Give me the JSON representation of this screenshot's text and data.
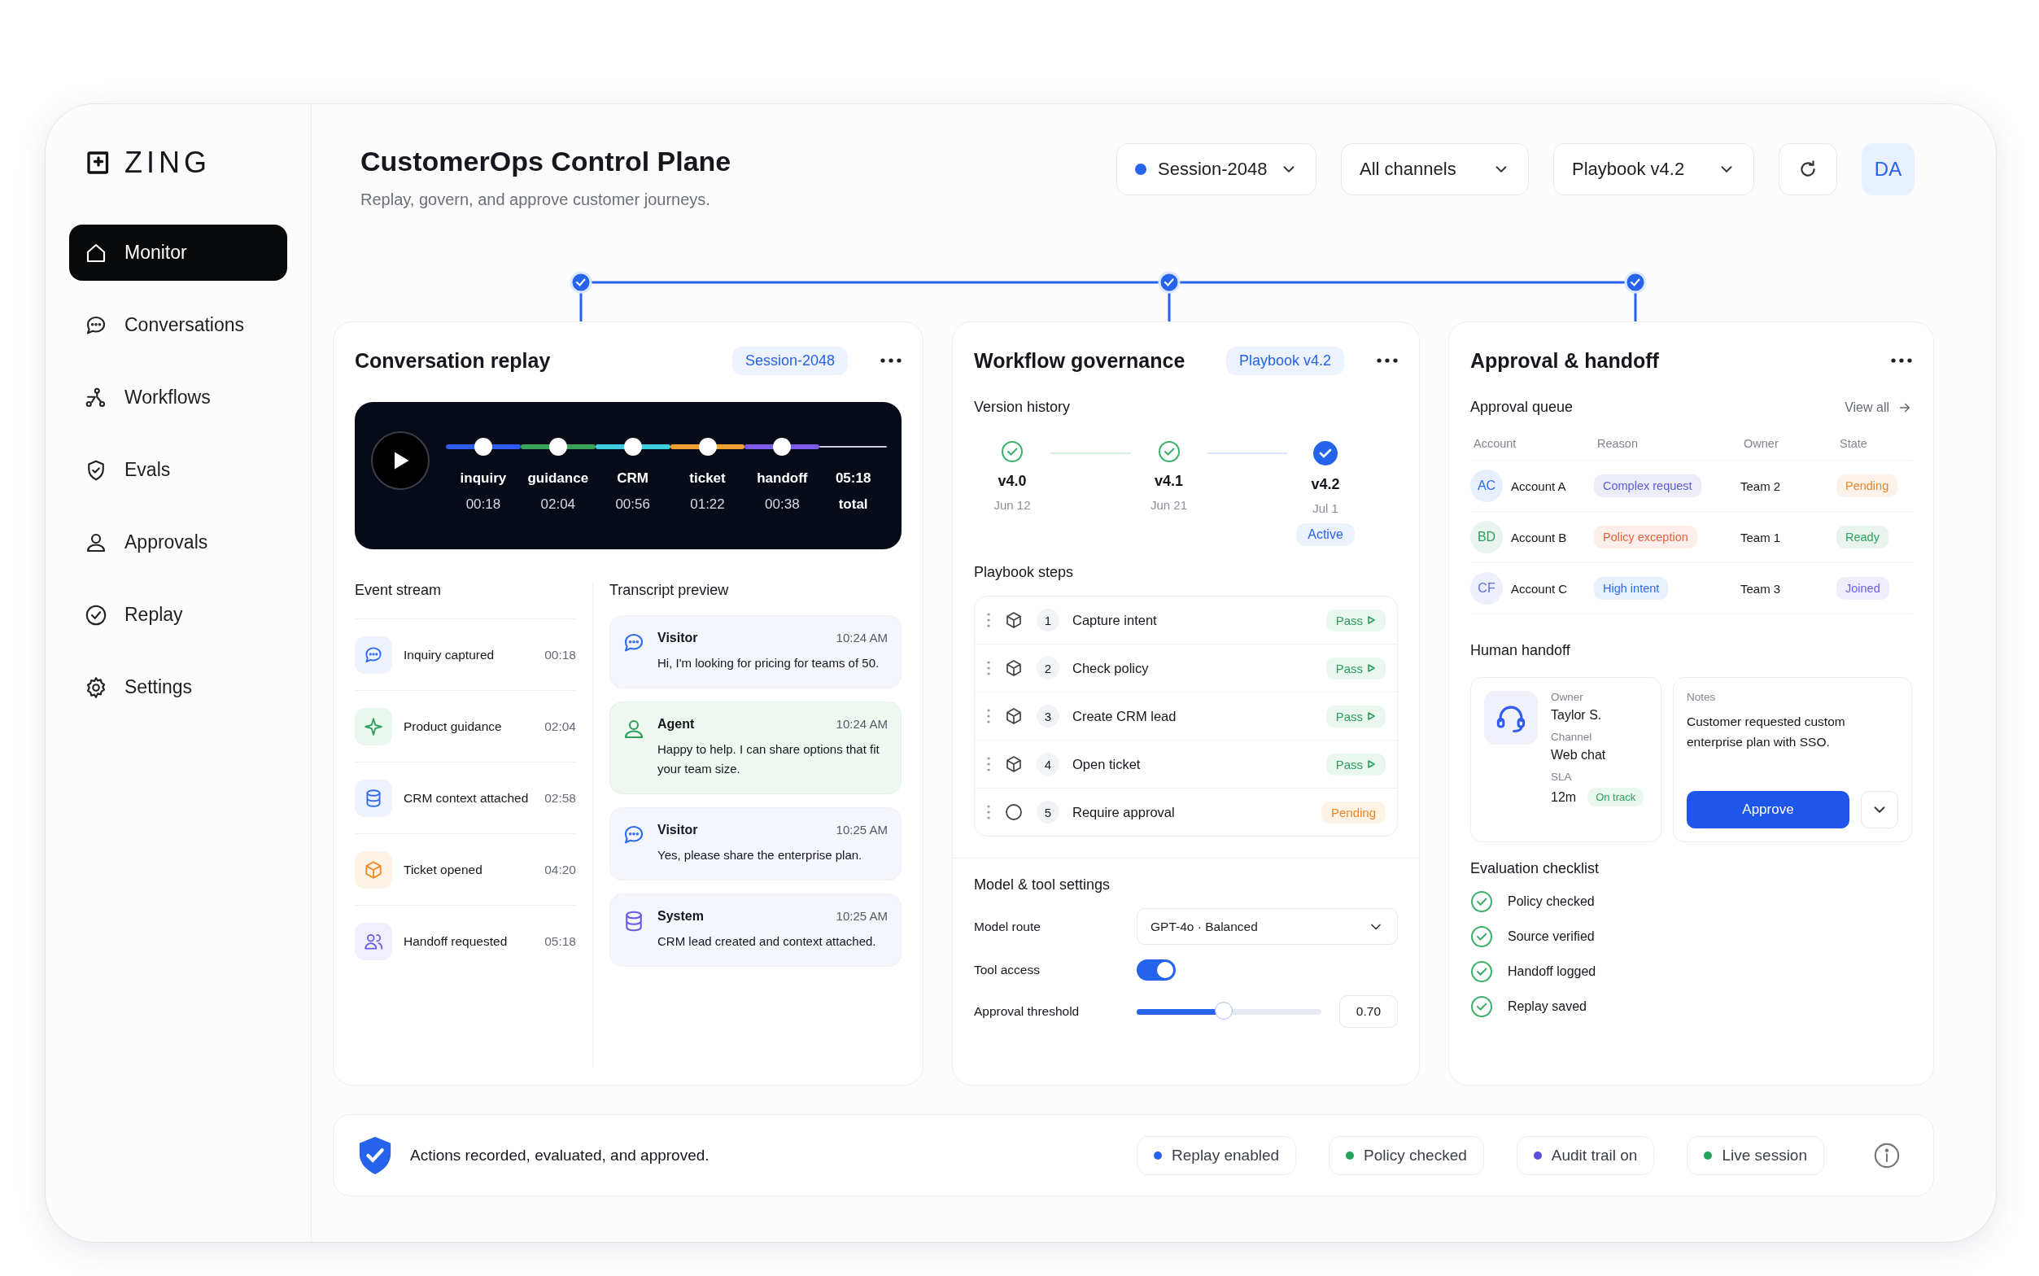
{
  "app": {
    "logo": "ZING"
  },
  "sidebar": {
    "items": [
      {
        "label": "Monitor",
        "kind": "home",
        "selected": true
      },
      {
        "label": "Conversations",
        "kind": "chat",
        "selected": false
      },
      {
        "label": "Workflows",
        "kind": "flow",
        "selected": false
      },
      {
        "label": "Evals",
        "kind": "shield",
        "selected": false
      },
      {
        "label": "Approvals",
        "kind": "person",
        "selected": false
      },
      {
        "label": "Replay",
        "kind": "check",
        "selected": false
      },
      {
        "label": "Settings",
        "kind": "gear",
        "selected": false
      }
    ]
  },
  "header": {
    "title": "CustomerOps Control Plane",
    "subtitle": "Replay, govern, and approve customer journeys.",
    "filters": [
      {
        "label": "Session-2048",
        "color": "#2563eb"
      },
      {
        "label": "All channels"
      },
      {
        "label": "Playbook v4.2"
      }
    ],
    "avatar": "DA"
  },
  "replay": {
    "title": "Conversation replay",
    "badge": "Session-2048",
    "segments": [
      {
        "label": "inquiry",
        "time": "00:18",
        "color": "#2f5cf0"
      },
      {
        "label": "guidance",
        "time": "02:04",
        "color": "#3aa35a"
      },
      {
        "label": "CRM",
        "time": "00:56",
        "color": "#3ccfe0"
      },
      {
        "label": "ticket",
        "time": "01:22",
        "color": "#f0a030"
      },
      {
        "label": "handoff",
        "time": "00:38",
        "color": "#7c5ce6"
      }
    ],
    "total": {
      "time": "05:18",
      "label": "total"
    },
    "event_stream": {
      "title": "Event stream",
      "events": [
        {
          "label": "Inquiry captured",
          "time": "00:18",
          "kind": "chat"
        },
        {
          "label": "Product guidance",
          "time": "02:04",
          "kind": "spark"
        },
        {
          "label": "CRM context attached",
          "time": "02:58",
          "kind": "database"
        },
        {
          "label": "Ticket opened",
          "time": "04:20",
          "kind": "box"
        },
        {
          "label": "Handoff requested",
          "time": "05:18",
          "kind": "users"
        }
      ]
    },
    "transcript": {
      "title": "Transcript preview",
      "messages": [
        {
          "speaker": "Visitor",
          "time": "10:24 AM",
          "text": "Hi, I'm looking for pricing for teams of 50.",
          "kind": "visitor"
        },
        {
          "speaker": "Agent",
          "time": "10:24 AM",
          "text": "Happy to help. I can share options that fit your team size.",
          "kind": "agent"
        },
        {
          "speaker": "Visitor",
          "time": "10:25 AM",
          "text": "Yes, please share the enterprise plan.",
          "kind": "visitor"
        },
        {
          "speaker": "System",
          "time": "10:25 AM",
          "text": "CRM lead created and context attached.",
          "kind": "system"
        }
      ]
    }
  },
  "governance": {
    "title": "Workflow governance",
    "badge": "Playbook v4.2",
    "version_history": {
      "title": "Version history",
      "versions": [
        {
          "version": "v4.0",
          "date": "Jun 12",
          "active": false
        },
        {
          "version": "v4.1",
          "date": "Jun 21",
          "active": false
        },
        {
          "version": "v4.2",
          "date": "Jul 1",
          "active": true,
          "tag": "Active"
        }
      ]
    },
    "playbook_steps": {
      "title": "Playbook steps",
      "steps": [
        {
          "number": "1",
          "name": "Capture intent",
          "status": "Pass",
          "kind": "pass"
        },
        {
          "number": "2",
          "name": "Check policy",
          "status": "Pass",
          "kind": "pass"
        },
        {
          "number": "3",
          "name": "Create CRM lead",
          "status": "Pass",
          "kind": "pass"
        },
        {
          "number": "4",
          "name": "Open ticket",
          "status": "Pass",
          "kind": "pass"
        },
        {
          "number": "5",
          "name": "Require approval",
          "status": "Pending",
          "kind": "pending"
        }
      ]
    },
    "settings": {
      "title": "Model & tool settings",
      "model_route": {
        "label": "Model route",
        "value": "GPT-4o · Balanced"
      },
      "tool_access": {
        "label": "Tool access",
        "on": true
      },
      "approval_threshold": {
        "label": "Approval threshold",
        "level": 0.47,
        "value": "0.70"
      }
    }
  },
  "approval": {
    "title": "Approval & handoff",
    "queue": {
      "title": "Approval queue",
      "link": "View all",
      "columns": [
        "Account",
        "Reason",
        "Owner",
        "State"
      ],
      "rows": [
        {
          "account": {
            "initials": "AC",
            "name": "Account A",
            "color": "#2f6bf0"
          },
          "reason": {
            "text": "Complex request",
            "color": "#5b5bd6"
          },
          "owner": "Team 2",
          "state": {
            "text": "Pending",
            "color": "#e8862c"
          }
        },
        {
          "account": {
            "initials": "BD",
            "name": "Account B",
            "color": "#2e9e5b"
          },
          "reason": {
            "text": "Policy exception",
            "color": "#e8603c"
          },
          "owner": "Team 1",
          "state": {
            "text": "Ready",
            "color": "#2e9e5b"
          }
        },
        {
          "account": {
            "initials": "CF",
            "name": "Account C",
            "color": "#5b6fe0"
          },
          "reason": {
            "text": "High intent",
            "color": "#2f6bf0"
          },
          "owner": "Team 3",
          "state": {
            "text": "Joined",
            "color": "#6b5ce7"
          }
        }
      ]
    },
    "handoff": {
      "title": "Human handoff",
      "fields": [
        {
          "label": "Owner",
          "value": "Taylor S."
        },
        {
          "label": "Channel",
          "value": "Web chat"
        },
        {
          "label": "SLA",
          "value": "12m",
          "badge": "On track"
        }
      ],
      "notes": {
        "label": "Notes",
        "text": "Customer requested custom enterprise plan with SSO."
      },
      "action": "Approve"
    },
    "checklist": {
      "title": "Evaluation checklist",
      "items": [
        {
          "label": "Policy checked",
          "checked": true
        },
        {
          "label": "Source verified",
          "checked": true
        },
        {
          "label": "Handoff logged",
          "checked": true
        },
        {
          "label": "Replay saved",
          "checked": true
        }
      ]
    }
  },
  "footer": {
    "message": "Actions recorded, evaluated, and approved.",
    "statuses": [
      {
        "label": "Replay enabled",
        "color": "#2563eb"
      },
      {
        "label": "Policy checked",
        "color": "#22a55a"
      },
      {
        "label": "Audit trail on",
        "color": "#5b4fe0"
      },
      {
        "label": "Live session",
        "color": "#22a55a"
      }
    ]
  }
}
